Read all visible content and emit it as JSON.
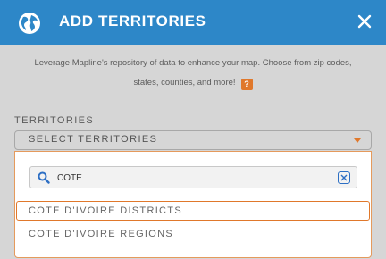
{
  "header": {
    "title": "ADD TERRITORIES",
    "icon": "globe-icon",
    "close_icon": "close-icon",
    "bg_color": "#2d87c8"
  },
  "description": {
    "line1": "Leverage Mapline's repository of data to enhance your map. Choose from zip codes,",
    "line2": "states, counties, and more!",
    "help_label": "?"
  },
  "territories": {
    "label": "TERRITORIES",
    "select_placeholder": "SELECT TERRITORIES",
    "search": {
      "value": "COTE",
      "icon": "search-icon",
      "clear_icon": "clear-icon"
    },
    "options": [
      {
        "label": "COTE D'IVOIRE DISTRICTS",
        "highlighted": true
      },
      {
        "label": "COTE D'IVOIRE REGIONS",
        "highlighted": false
      }
    ]
  },
  "colors": {
    "accent": "#e0782b",
    "clear_button": "#2d6fc4"
  }
}
